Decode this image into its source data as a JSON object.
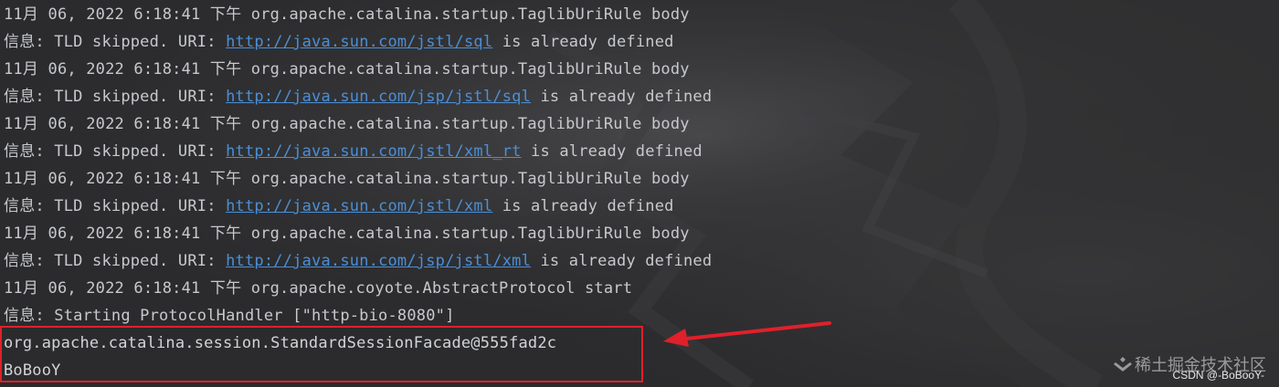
{
  "lines": [
    {
      "pre": "11月 06, 2022 6:18:41 下午 org.apache.catalina.startup.TaglibUriRule body"
    },
    {
      "pre": "信息: TLD skipped. URI: ",
      "url": "http://java.sun.com/jstl/sql",
      "post": " is already defined"
    },
    {
      "pre": "11月 06, 2022 6:18:41 下午 org.apache.catalina.startup.TaglibUriRule body"
    },
    {
      "pre": "信息: TLD skipped. URI: ",
      "url": "http://java.sun.com/jsp/jstl/sql",
      "post": " is already defined"
    },
    {
      "pre": "11月 06, 2022 6:18:41 下午 org.apache.catalina.startup.TaglibUriRule body"
    },
    {
      "pre": "信息: TLD skipped. URI: ",
      "url": "http://java.sun.com/jstl/xml_rt",
      "post": " is already defined"
    },
    {
      "pre": "11月 06, 2022 6:18:41 下午 org.apache.catalina.startup.TaglibUriRule body"
    },
    {
      "pre": "信息: TLD skipped. URI: ",
      "url": "http://java.sun.com/jstl/xml",
      "post": " is already defined"
    },
    {
      "pre": "11月 06, 2022 6:18:41 下午 org.apache.catalina.startup.TaglibUriRule body"
    },
    {
      "pre": "信息: TLD skipped. URI: ",
      "url": "http://java.sun.com/jsp/jstl/xml",
      "post": " is already defined"
    },
    {
      "pre": "11月 06, 2022 6:18:41 下午 org.apache.coyote.AbstractProtocol start"
    },
    {
      "pre": "信息: Starting ProtocolHandler [\"http-bio-8080\"]"
    },
    {
      "pre": "org.apache.catalina.session.StandardSessionFacade@555fad2c"
    },
    {
      "pre": "BoBooY"
    }
  ],
  "watermark": {
    "site": "稀土掘金技术社区",
    "author": "CSDN @-BoBooY-"
  },
  "colors": {
    "background": "#2b2b2d",
    "text": "#c7c9cc",
    "link": "#4b8fd6",
    "highlight": "#e0202a"
  },
  "icons": [
    "arrow-icon",
    "juejin-logo-icon"
  ]
}
